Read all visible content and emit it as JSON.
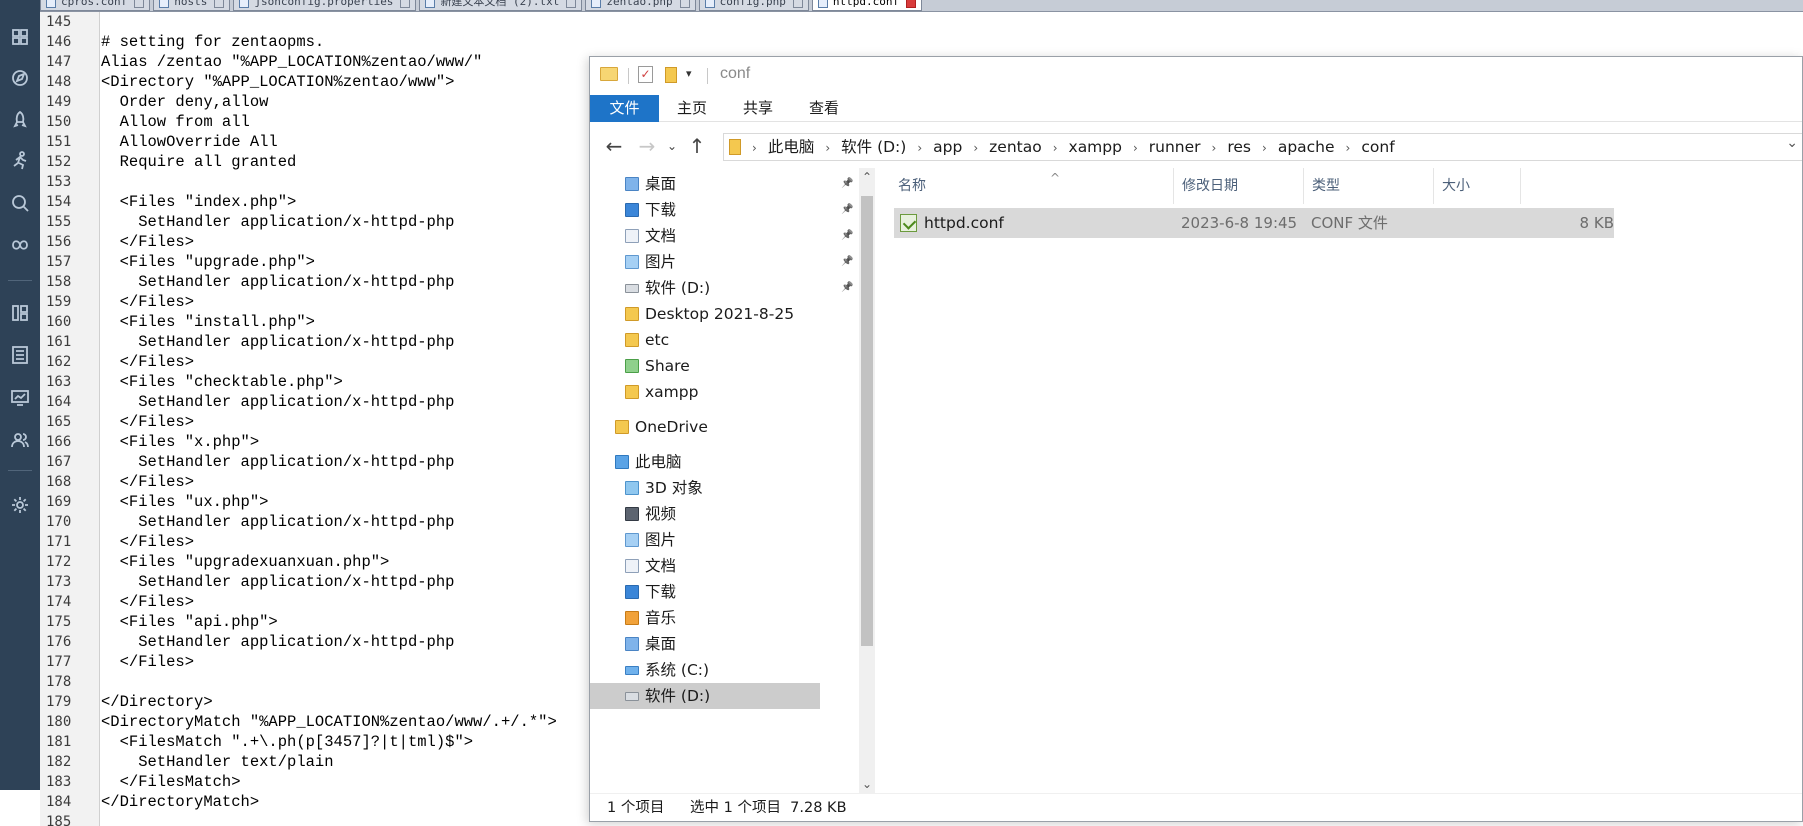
{
  "editor": {
    "tabs": [
      {
        "label": "cpros.conf",
        "active": false
      },
      {
        "label": "hosts",
        "active": false
      },
      {
        "label": "jsonconfig.properties",
        "active": false
      },
      {
        "label": "新建文本文档 (2).txt",
        "active": false
      },
      {
        "label": "zentao.php",
        "active": false
      },
      {
        "label": "config.php",
        "active": false
      },
      {
        "label": "httpd.conf",
        "active": true
      }
    ],
    "line_numbers": [
      "145",
      "146",
      "147",
      "148",
      "149",
      "150",
      "151",
      "152",
      "153",
      "154",
      "155",
      "156",
      "157",
      "158",
      "159",
      "160",
      "161",
      "162",
      "163",
      "164",
      "165",
      "166",
      "167",
      "168",
      "169",
      "170",
      "171",
      "172",
      "173",
      "174",
      "175",
      "176",
      "177",
      "178",
      "179",
      "180",
      "181",
      "182",
      "183",
      "184",
      "185"
    ],
    "lines": [
      "",
      "# setting for zentaopms.",
      "Alias /zentao \"%APP_LOCATION%zentao/www/\"",
      "<Directory \"%APP_LOCATION%zentao/www\">",
      "  Order deny,allow",
      "  Allow from all",
      "  AllowOverride All",
      "  Require all granted",
      "",
      "  <Files \"index.php\">",
      "    SetHandler application/x-httpd-php",
      "  </Files>",
      "  <Files \"upgrade.php\">",
      "    SetHandler application/x-httpd-php",
      "  </Files>",
      "  <Files \"install.php\">",
      "    SetHandler application/x-httpd-php",
      "  </Files>",
      "  <Files \"checktable.php\">",
      "    SetHandler application/x-httpd-php",
      "  </Files>",
      "  <Files \"x.php\">",
      "    SetHandler application/x-httpd-php",
      "  </Files>",
      "  <Files \"ux.php\">",
      "    SetHandler application/x-httpd-php",
      "  </Files>",
      "  <Files \"upgradexuanxuan.php\">",
      "    SetHandler application/x-httpd-php",
      "  </Files>",
      "  <Files \"api.php\">",
      "    SetHandler application/x-httpd-php",
      "  </Files>",
      "",
      "</Directory>",
      "<DirectoryMatch \"%APP_LOCATION%zentao/www/.+/.*\">",
      "  <FilesMatch \".+\\.ph(p[3457]?|t|tml)$\">",
      "    SetHandler text/plain",
      "  </FilesMatch>",
      "</DirectoryMatch>",
      ""
    ]
  },
  "sidebar_icons": [
    "apps-icon",
    "compass-icon",
    "rocket-icon",
    "runner-icon",
    "search-icon",
    "infinity-icon",
    "columns-icon",
    "list-icon",
    "monitor-icon",
    "users-icon",
    "gear-icon"
  ],
  "explorer": {
    "title": "conf",
    "ribbon_tabs": [
      "文件",
      "主页",
      "共享",
      "查看"
    ],
    "breadcrumbs": [
      "此电脑",
      "软件 (D:)",
      "app",
      "zentao",
      "xampp",
      "runner",
      "res",
      "apache",
      "conf"
    ],
    "nav_items": [
      {
        "label": "桌面",
        "icon": "ico-folder-blue",
        "pinned": true,
        "indent": 1
      },
      {
        "label": "下载",
        "icon": "ico-down",
        "pinned": true,
        "indent": 1
      },
      {
        "label": "文档",
        "icon": "ico-doc",
        "pinned": true,
        "indent": 1
      },
      {
        "label": "图片",
        "icon": "ico-pic",
        "pinned": true,
        "indent": 1
      },
      {
        "label": "软件 (D:)",
        "icon": "ico-drive",
        "pinned": true,
        "indent": 1
      },
      {
        "label": "Desktop 2021-8-25",
        "icon": "ico-folder",
        "pinned": false,
        "indent": 1
      },
      {
        "label": "etc",
        "icon": "ico-folder",
        "pinned": false,
        "indent": 1
      },
      {
        "label": "Share",
        "icon": "ico-share",
        "pinned": false,
        "indent": 1
      },
      {
        "label": "xampp",
        "icon": "ico-folder",
        "pinned": false,
        "indent": 1
      },
      {
        "label": "OneDrive",
        "icon": "ico-onedrive",
        "pinned": false,
        "indent": 0
      },
      {
        "label": "此电脑",
        "icon": "ico-pc",
        "pinned": false,
        "indent": 0
      },
      {
        "label": "3D 对象",
        "icon": "ico-3d",
        "pinned": false,
        "indent": 1
      },
      {
        "label": "视频",
        "icon": "ico-video",
        "pinned": false,
        "indent": 1
      },
      {
        "label": "图片",
        "icon": "ico-pic",
        "pinned": false,
        "indent": 1
      },
      {
        "label": "文档",
        "icon": "ico-doc",
        "pinned": false,
        "indent": 1
      },
      {
        "label": "下载",
        "icon": "ico-down",
        "pinned": false,
        "indent": 1
      },
      {
        "label": "音乐",
        "icon": "ico-music",
        "pinned": false,
        "indent": 1
      },
      {
        "label": "桌面",
        "icon": "ico-folder-blue",
        "pinned": false,
        "indent": 1
      },
      {
        "label": "系统 (C:)",
        "icon": "ico-sys",
        "pinned": false,
        "indent": 1
      },
      {
        "label": "软件 (D:)",
        "icon": "ico-drive",
        "pinned": false,
        "indent": 1,
        "selected": true
      }
    ],
    "columns": {
      "name": "名称",
      "modified": "修改日期",
      "type": "类型",
      "size": "大小"
    },
    "files": [
      {
        "name": "httpd.conf",
        "modified": "2023-6-8 19:45",
        "type": "CONF 文件",
        "size": "8 KB"
      }
    ],
    "status": {
      "count": "1 个项目",
      "selection": "选中 1 个项目  7.28 KB"
    }
  }
}
